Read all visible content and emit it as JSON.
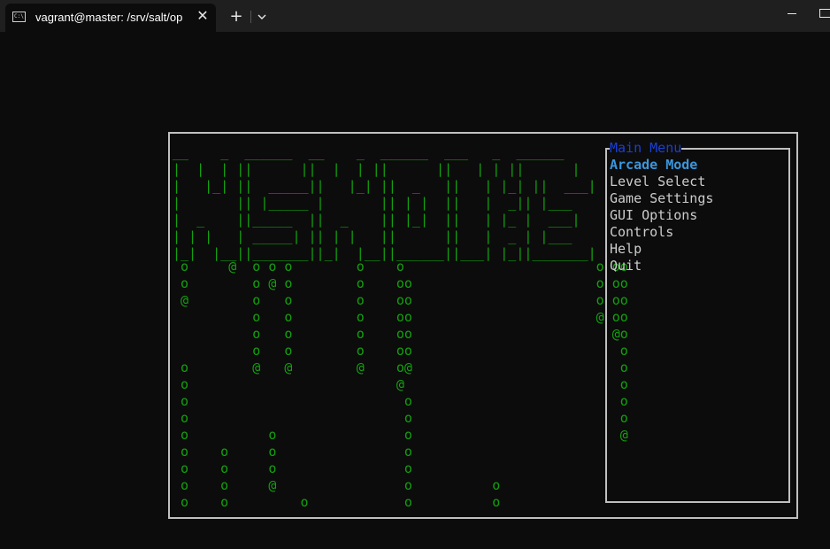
{
  "window": {
    "tab_title": "vagrant@master: /srv/salt/op",
    "tab_icon": "terminal-icon",
    "tab_icon_glyph": "C:\\",
    "close_glyph": "✕",
    "new_tab_glyph": "+"
  },
  "game": {
    "logo_lines": [
      "__    _  ______  __    _  ______  ___   _  ______",
      "|  |  | ||      ||  |  | ||      ||   | | ||      |",
      "|   |_| ||  _____||   |_| ||  _   ||   | |_| ||  ___|",
      "|       || |_____ |       || | |  ||   |  _|| |___",
      "|  _    ||_____  ||  _    || |_|  ||   | |_ |  ___|",
      "| | |   | _____| || | |   ||      ||   |  _ | |___",
      "|_|  |__||_______||_|  |__||______||___| |_||_______|"
    ],
    "rain_lines": [
      " o     @  o o o        o    o                        o oo",
      " o        o @ o        o    oo                       o oo",
      " @        o   o        o    oo                       o oo",
      "          o   o        o    oo                       @ oo",
      "          o   o        o    oo                         @o",
      "          o   o        o    oo                          o",
      " o        @   @        @    o@                          o",
      " o                          @                           o",
      " o                           o                          o",
      " o                           o                          o",
      " o          o                o                          @",
      " o    o     o                o",
      " o    o     o                o",
      " o    o     @                o          o",
      " o    o         o            o          o"
    ],
    "colors": {
      "rain_green": "#13a10e",
      "menu_title_blue": "#1a3fd6",
      "selected_blue": "#3a96dd",
      "menu_text": "#cccccc",
      "background": "#0c0c0c"
    }
  },
  "menu": {
    "title": "Main Menu",
    "items": [
      {
        "label": "Arcade Mode",
        "selected": true
      },
      {
        "label": "Level Select",
        "selected": false
      },
      {
        "label": "Game Settings",
        "selected": false
      },
      {
        "label": "GUI Options",
        "selected": false
      },
      {
        "label": "Controls",
        "selected": false
      },
      {
        "label": "Help",
        "selected": false
      },
      {
        "label": "Quit",
        "selected": false
      }
    ]
  }
}
